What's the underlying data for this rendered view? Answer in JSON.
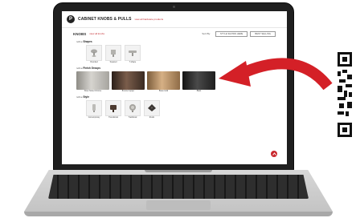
{
  "page": {
    "logo_letter": "P",
    "brand": "CABINET KNOBS & PULLS",
    "brand_link": "view all hardware products",
    "section_title": "KNOBS",
    "section_link": "view all knobs",
    "sort_label": "Sort By:",
    "sort_options": [
      "STYLE SHOWN HERE",
      "BEST SELLING"
    ],
    "groups": {
      "shapes": {
        "label_prefix": "refine",
        "label": "Shapes",
        "items": [
          "Rounded",
          "Squared",
          "T-shape"
        ]
      },
      "finish": {
        "label_prefix": "refine",
        "label": "Finish Groups",
        "items": [
          {
            "name": "Silver Nickel Chrome",
            "color": "#b9b7b2"
          },
          {
            "name": "Bronze Copper",
            "color": "#4d3b31"
          },
          {
            "name": "Brass Gold",
            "color": "#b08a5f"
          },
          {
            "name": "Black",
            "color": "#2c2c2c"
          }
        ]
      },
      "style": {
        "label_prefix": "refine",
        "label": "Style",
        "items": [
          "Contemporary",
          "Transitional",
          "Traditional",
          "Rustic"
        ]
      }
    },
    "back_to_top_icon": "chevron-up-icon"
  },
  "colors": {
    "accent": "#c9272d",
    "arrow": "#d42027"
  }
}
